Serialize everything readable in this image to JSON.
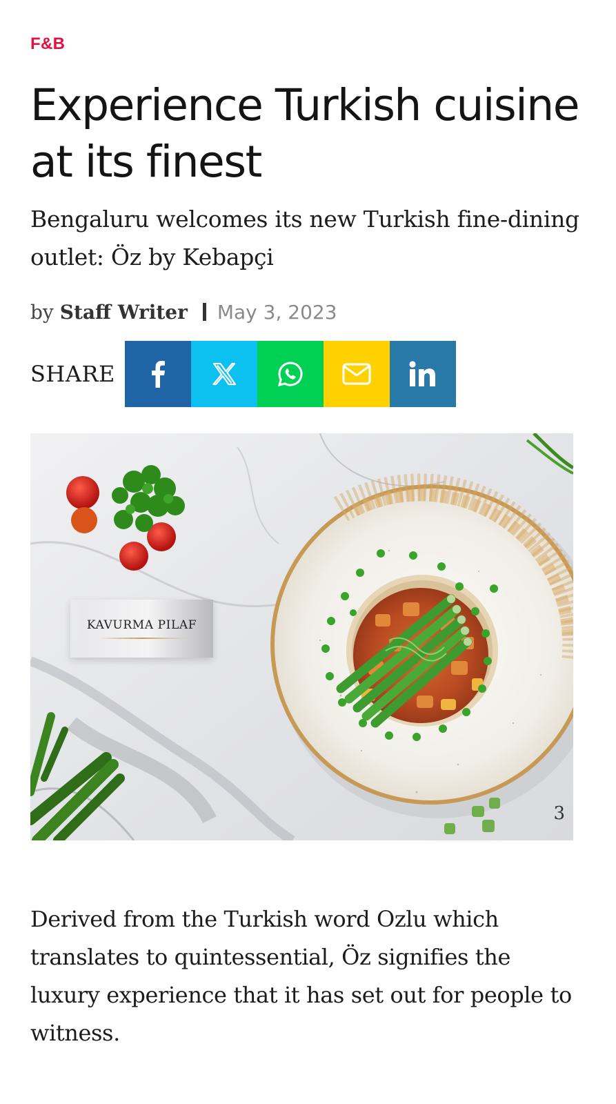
{
  "article": {
    "category": "F&B",
    "title": "Experience Turkish cuisine at its finest",
    "subtitle": "Bengaluru welcomes its new Turkish fine-dining outlet: Öz by Kebapçi",
    "byline_prefix": "by",
    "author": "Staff Writer",
    "date": "May 3, 2023"
  },
  "share": {
    "label": "SHARE",
    "buttons": [
      {
        "network": "facebook",
        "icon": "facebook-icon",
        "color": "#1f65a6"
      },
      {
        "network": "x",
        "icon": "x-icon",
        "color": "#0cc0ef"
      },
      {
        "network": "whatsapp",
        "icon": "whatsapp-icon",
        "color": "#00d154"
      },
      {
        "network": "email",
        "icon": "mail-icon",
        "color": "#ffd100"
      },
      {
        "network": "linkedin",
        "icon": "linkedin-icon",
        "color": "#2878a8"
      }
    ]
  },
  "hero_image": {
    "dish_label": "KAVURMA PILAF",
    "slide_number": "3"
  },
  "body": {
    "paragraph_1": "Derived from the Turkish word Ozlu which translates to quintessential, Öz signifies the luxury experience that it has set out for people to witness."
  },
  "colors": {
    "category": "#e0123f",
    "facebook": "#1f65a6",
    "x": "#0cc0ef",
    "whatsapp": "#00d154",
    "email": "#ffd100",
    "linkedin": "#2878a8"
  }
}
